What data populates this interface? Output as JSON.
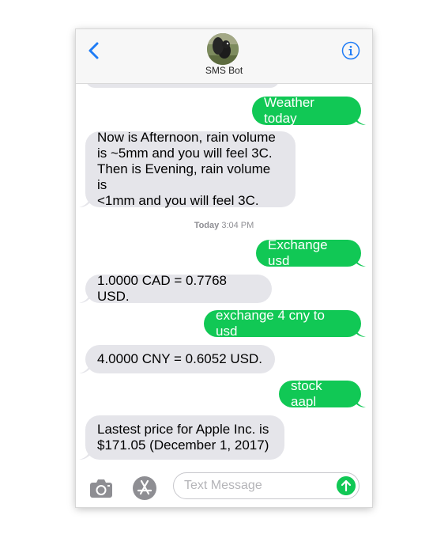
{
  "header": {
    "contact_name": "SMS Bot"
  },
  "timestamp": {
    "day": "Today",
    "time": "3:04 PM"
  },
  "messages": [
    {
      "direction": "outgoing",
      "text": "Weather today"
    },
    {
      "direction": "incoming",
      "text": "Now is Afternoon, rain volume\nis ~5mm and you will feel 3C.\nThen is Evening, rain volume is\n<1mm and you will feel 3C."
    },
    {
      "direction": "outgoing",
      "text": "Exchange usd"
    },
    {
      "direction": "incoming",
      "text": "1.0000 CAD = 0.7768 USD."
    },
    {
      "direction": "outgoing",
      "text": "exchange 4 cny to usd"
    },
    {
      "direction": "incoming",
      "text": "4.0000 CNY = 0.6052 USD."
    },
    {
      "direction": "outgoing",
      "text": "stock aapl"
    },
    {
      "direction": "incoming",
      "text": "Lastest price for Apple Inc. is\n$171.05 (December 1, 2017)"
    }
  ],
  "input": {
    "placeholder": "Text Message"
  },
  "icons": {
    "back": "chevron-left-icon",
    "info": "info-icon",
    "camera": "camera-icon",
    "apps": "app-store-icon",
    "send": "send-arrow-icon"
  },
  "colors": {
    "outgoing_bubble": "#11c855",
    "incoming_bubble": "#e5e5ea",
    "accent": "#1f7cf6"
  }
}
